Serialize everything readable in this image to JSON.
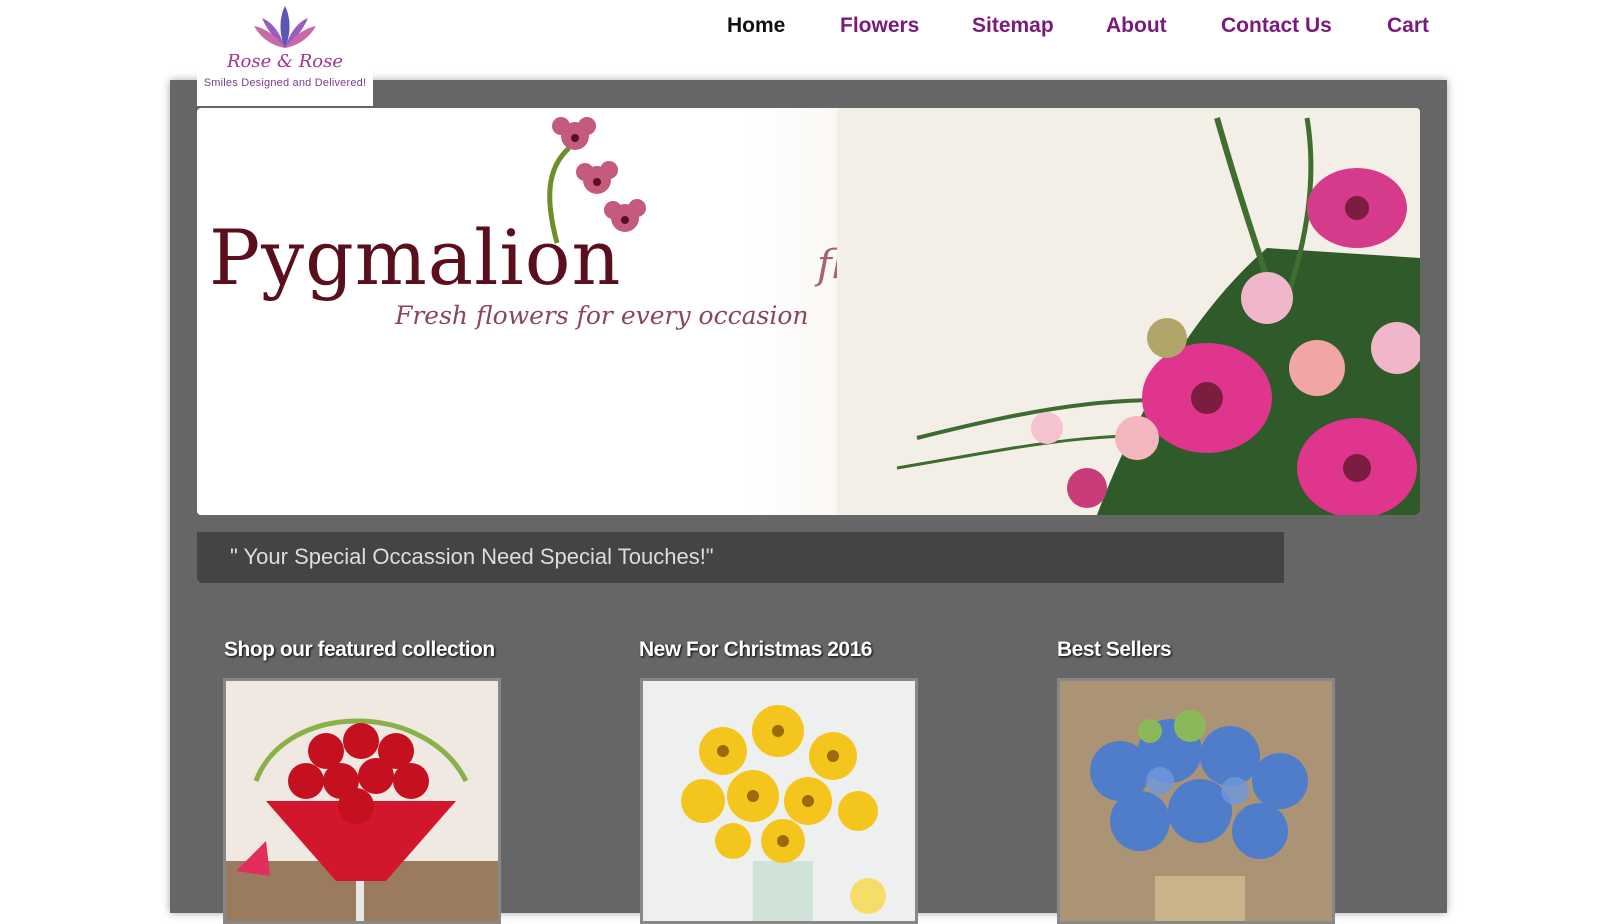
{
  "nav": {
    "items": [
      {
        "label": "Home",
        "active": true
      },
      {
        "label": "Flowers",
        "active": false
      },
      {
        "label": "Sitemap",
        "active": false
      },
      {
        "label": "About",
        "active": false
      },
      {
        "label": "Contact Us",
        "active": false
      },
      {
        "label": "Cart",
        "active": false
      }
    ]
  },
  "logo": {
    "brand": "Rose & Rose",
    "tagline": "Smiles Designed and Delivered!"
  },
  "banner": {
    "title": "Pygmalion",
    "subtitle": "florist",
    "slogan": "Fresh flowers for every occasion"
  },
  "quote": "\" Your Special Occassion Need Special Touches!\"",
  "sections": [
    {
      "title": "Shop our featured collection"
    },
    {
      "title": "New For Christmas 2016"
    },
    {
      "title": "Best Sellers"
    }
  ],
  "colors": {
    "nav_link": "#7a1a7d",
    "nav_active": "#111111",
    "panel_bg": "#666666",
    "quote_bg": "#444444"
  }
}
